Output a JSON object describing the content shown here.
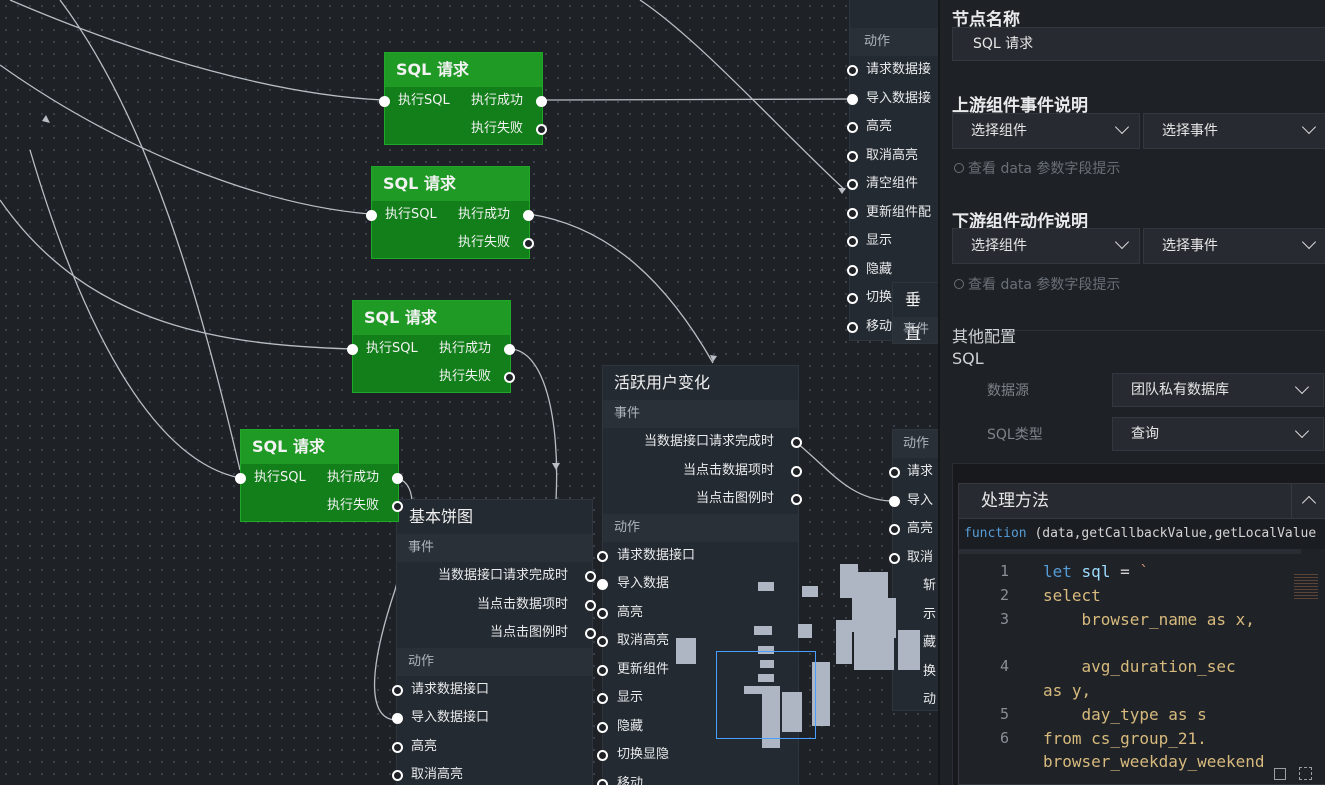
{
  "sql_nodes": [
    {
      "title": "SQL 请求",
      "in": "执行SQL",
      "ok": "执行成功",
      "fail": "执行失败"
    },
    {
      "title": "SQL 请求",
      "in": "执行SQL",
      "ok": "执行成功",
      "fail": "执行失败"
    },
    {
      "title": "SQL 请求",
      "in": "执行SQL",
      "ok": "执行成功",
      "fail": "执行失败"
    },
    {
      "title": "SQL 请求",
      "in": "执行SQL",
      "ok": "执行成功",
      "fail": "执行失败"
    }
  ],
  "top_right_node": {
    "section": "动作",
    "actions": [
      "请求数据接",
      "导入数据接",
      "高亮",
      "取消高亮",
      "清空组件",
      "更新组件配",
      "显示",
      "隐藏",
      "切换",
      "移动"
    ]
  },
  "vertical_node": {
    "title": "垂直",
    "section": "事件"
  },
  "active_node": {
    "title": "活跃用户变化",
    "events_label": "事件",
    "events": [
      "当数据接口请求完成时",
      "当点击数据项时",
      "当点击图例时"
    ],
    "actions_label": "动作",
    "actions": [
      "请求数据接口",
      "导入数据",
      "高亮",
      "取消高亮",
      "更新组件",
      "显示",
      "隐藏",
      "切换显隐",
      "移动"
    ]
  },
  "pie_node": {
    "title": "基本饼图",
    "events_label": "事件",
    "events": [
      "当数据接口请求完成时",
      "当点击数据项时",
      "当点击图例时"
    ],
    "actions_label": "动作",
    "actions": [
      "请求数据接口",
      "导入数据接口",
      "高亮",
      "取消高亮"
    ]
  },
  "mid_right_node": {
    "section": "动作",
    "actions": [
      "请求",
      "导入",
      "高亮",
      "取消"
    ],
    "extra": [
      "斩",
      "示",
      "藏",
      "换",
      "动"
    ]
  },
  "panel": {
    "node_name_label": "节点名称",
    "node_name_value": "SQL 请求",
    "upstream_label": "上游组件事件说明",
    "upstream_component": "选择组件",
    "upstream_event": "选择事件",
    "upstream_hint": "查看 data 参数字段提示",
    "downstream_label": "下游组件动作说明",
    "downstream_component": "选择组件",
    "downstream_event": "选择事件",
    "downstream_hint": "查看 data 参数字段提示",
    "other_config": "其他配置",
    "sql_label": "SQL",
    "datasource_label": "数据源",
    "datasource_value": "团队私有数据库",
    "sqltype_label": "SQL类型",
    "sqltype_value": "查询",
    "method_label": "处理方法",
    "signature_kw": "function",
    "signature_rest": "(data,getCallbackValue,getLocalValue",
    "code_lines": [
      {
        "n": "1",
        "t": "let sql = `"
      },
      {
        "n": "2",
        "t": "select"
      },
      {
        "n": "3",
        "t": "    browser_name as x,"
      },
      {
        "n": "",
        "t": ""
      },
      {
        "n": "4",
        "t": "    avg_duration_sec"
      },
      {
        "n": "",
        "t": "as y,"
      },
      {
        "n": "5",
        "t": "    day_type as s"
      },
      {
        "n": "6",
        "t": "from cs_group_21."
      },
      {
        "n": "",
        "t": "browser_weekday_weekend"
      }
    ]
  },
  "colors": {
    "node_green": "#1f9a25",
    "accent_blue": "#4a9eff",
    "panel_bg": "#1e2125"
  }
}
